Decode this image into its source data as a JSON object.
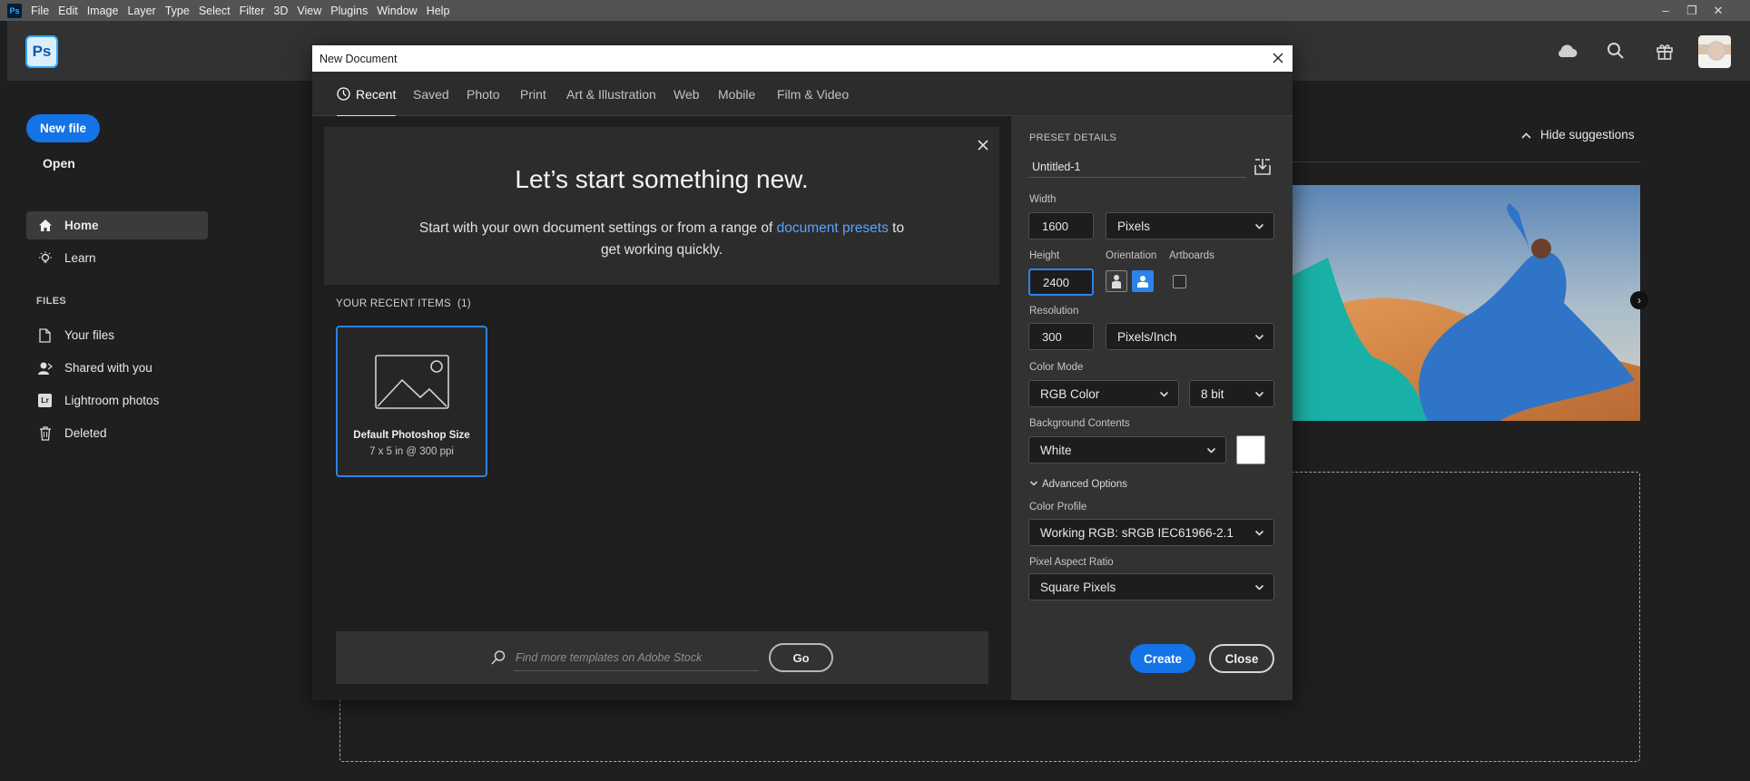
{
  "menubar": {
    "app_icon": "Ps",
    "items": [
      "File",
      "Edit",
      "Image",
      "Layer",
      "Type",
      "Select",
      "Filter",
      "3D",
      "View",
      "Plugins",
      "Window",
      "Help"
    ]
  },
  "header": {
    "logo": "Ps",
    "icons": [
      "cloud-icon",
      "search-icon",
      "gift-icon"
    ]
  },
  "sidebar": {
    "new_file": "New file",
    "open": "Open",
    "nav": [
      {
        "label": "Home",
        "icon": "home-icon",
        "active": true
      },
      {
        "label": "Learn",
        "icon": "lightbulb-icon",
        "active": false
      }
    ],
    "files_header": "FILES",
    "files": [
      {
        "label": "Your files",
        "icon": "file-icon"
      },
      {
        "label": "Shared with you",
        "icon": "shared-user-icon"
      },
      {
        "label": "Lightroom photos",
        "icon": "lightroom-icon",
        "badge": "Lr"
      },
      {
        "label": "Deleted",
        "icon": "trash-icon"
      }
    ]
  },
  "home": {
    "hide_suggestions": "Hide suggestions"
  },
  "dialog": {
    "title": "New Document",
    "tabs": [
      "Recent",
      "Saved",
      "Photo",
      "Print",
      "Art & Illustration",
      "Web",
      "Mobile",
      "Film & Video"
    ],
    "active_tab": "Recent",
    "welcome": {
      "title": "Let’s start something new.",
      "text_before": "Start with your own document settings or from a range of ",
      "link": "document presets",
      "text_after": " to get working quickly."
    },
    "recent": {
      "header": "YOUR RECENT ITEMS",
      "count": "(1)",
      "items": [
        {
          "name": "Default Photoshop Size",
          "size": "7 x 5 in @ 300 ppi"
        }
      ]
    },
    "stock": {
      "placeholder": "Find more templates on Adobe Stock",
      "go": "Go"
    },
    "preset": {
      "header": "PRESET DETAILS",
      "name": "Untitled-1",
      "width_label": "Width",
      "width": "1600",
      "width_unit": "Pixels",
      "height_label": "Height",
      "height": "2400",
      "orientation_label": "Orientation",
      "artboards_label": "Artboards",
      "resolution_label": "Resolution",
      "resolution": "300",
      "resolution_unit": "Pixels/Inch",
      "color_mode_label": "Color Mode",
      "color_mode": "RGB Color",
      "bit_depth": "8 bit",
      "background_label": "Background Contents",
      "background": "White",
      "background_color": "#ffffff",
      "advanced": "Advanced Options",
      "color_profile_label": "Color Profile",
      "color_profile": "Working RGB: sRGB IEC61966-2.1",
      "pixel_aspect_label": "Pixel Aspect Ratio",
      "pixel_aspect": "Square Pixels",
      "create": "Create",
      "close": "Close"
    }
  },
  "colors": {
    "accent": "#1473e6",
    "link": "#5aa3ff",
    "focus": "#2d83e8"
  }
}
